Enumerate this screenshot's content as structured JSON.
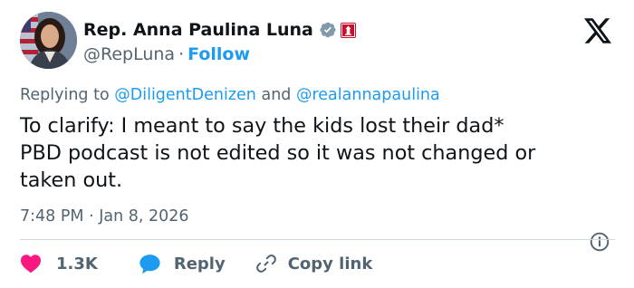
{
  "author": {
    "display_name": "Rep. Anna Paulina Luna",
    "handle": "@RepLuna",
    "separator": "·",
    "follow_label": "Follow",
    "verified_badge_color": "#829aab",
    "affiliate_badge_color": "#c8102e"
  },
  "reply_context": {
    "prefix": "Replying to",
    "mention_1": "@DiligentDenizen",
    "conjunction": "and",
    "mention_2": "@realannapaulina"
  },
  "tweet": {
    "lines": [
      "To clarify: I meant to say the kids lost their dad*",
      "PBD podcast is not edited so it was not changed or",
      "taken out."
    ],
    "timestamp": "7:48 PM · Jan 8, 2026"
  },
  "actions": {
    "like_count": "1.3K",
    "reply_label": "Reply",
    "copy_link_label": "Copy link"
  },
  "icons": {
    "logo": "x-logo-icon",
    "verified": "verified-badge-icon",
    "affiliate": "house-seal-icon",
    "info": "info-icon",
    "like": "heart-icon",
    "reply": "speech-bubble-icon",
    "copy": "link-icon"
  },
  "colors": {
    "accent": "#1d9bf0",
    "secondary_text": "#536471",
    "like": "#f91880",
    "divider": "#cfd9de"
  }
}
